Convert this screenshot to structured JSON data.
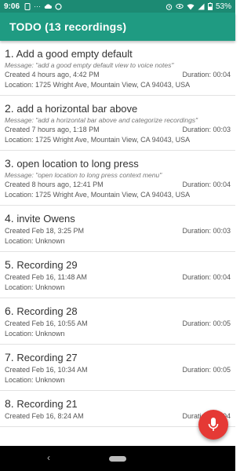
{
  "status_bar": {
    "time": "9:06",
    "battery": "53%",
    "left_icons": [
      "sim-icon",
      "sync-icon",
      "more-dots-icon",
      "cloud-icon",
      "data-saver-icon"
    ],
    "right_icons": [
      "alarm-icon",
      "eye-icon",
      "wifi-icon",
      "signal-icon",
      "battery-icon"
    ]
  },
  "app_bar": {
    "title": "TODO (13 recordings)"
  },
  "items": [
    {
      "number": "1.",
      "title": "Add a good empty default",
      "message": "Message: \"add a good empty default view to voice notes\"",
      "created": "Created 4 hours ago, 4:42 PM",
      "duration": "Duration: 00:04",
      "location": "Location: 1725 Wright Ave, Mountain View, CA 94043, USA"
    },
    {
      "number": "2.",
      "title": "add a horizontal bar above",
      "message": "Message: \"add a horizontal bar above and categorize recordings\"",
      "created": "Created 7 hours ago, 1:18 PM",
      "duration": "Duration: 00:03",
      "location": "Location: 1725 Wright Ave, Mountain View, CA 94043, USA"
    },
    {
      "number": "3.",
      "title": "open location to long press",
      "message": "Message: \"open location to long press context menu\"",
      "created": "Created 8 hours ago, 12:41 PM",
      "duration": "Duration: 00:04",
      "location": "Location: 1725 Wright Ave, Mountain View, CA 94043, USA"
    },
    {
      "number": "4.",
      "title": "invite Owens",
      "message": "",
      "created": "Created Feb 18, 3:25 PM",
      "duration": "Duration: 00:03",
      "location": "Location: Unknown"
    },
    {
      "number": "5.",
      "title": "Recording 29",
      "message": "",
      "created": "Created Feb 16, 11:48 AM",
      "duration": "Duration: 00:04",
      "location": "Location: Unknown"
    },
    {
      "number": "6.",
      "title": "Recording 28",
      "message": "",
      "created": "Created Feb 16, 10:55 AM",
      "duration": "Duration: 00:05",
      "location": "Location: Unknown"
    },
    {
      "number": "7.",
      "title": "Recording 27",
      "message": "",
      "created": "Created Feb 16, 10:34 AM",
      "duration": "Duration: 00:05",
      "location": "Location: Unknown"
    },
    {
      "number": "8.",
      "title": "Recording 21",
      "message": "",
      "created": "Created Feb 16, 8:24 AM",
      "duration": "Duration: 00:04",
      "location": ""
    }
  ],
  "fab": {
    "icon": "microphone-icon",
    "color": "#e53935"
  },
  "nav_bar": {
    "back_icon": "back-icon",
    "home_icon": "home-pill-icon"
  },
  "colors": {
    "status_bar": "#1c8a73",
    "app_bar": "#1f9b82",
    "nav_bar": "#000000"
  }
}
